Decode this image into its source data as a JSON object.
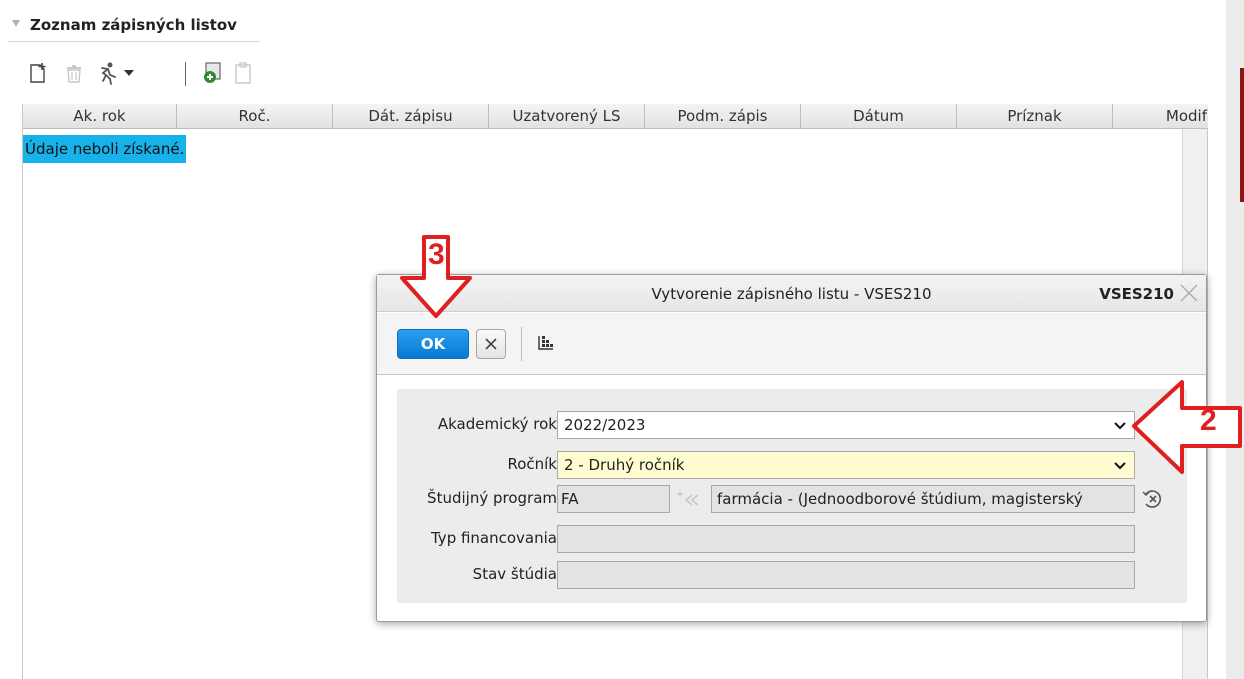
{
  "section": {
    "title": "Zoznam zápisných listov"
  },
  "toolbar": {
    "icons": [
      "new-document-icon",
      "delete-icon",
      "run-icon",
      "dropdown-arrow-icon",
      "import-icon",
      "clipboard-icon"
    ]
  },
  "grid": {
    "columns": [
      "Ak. rok",
      "Roč.",
      "Dát. zápisu",
      "Uzatvorený LS",
      "Podm. zápis",
      "Dátum",
      "Príznak",
      "Modif"
    ],
    "empty_message": "Údaje neboli získané."
  },
  "dialog": {
    "title": "Vytvorenie zápisného listu - VSES210",
    "code": "VSES210",
    "ok_label": "OK",
    "fields": {
      "academic_year": {
        "label": "Akademický rok",
        "value": "2022/2023"
      },
      "year_of_study": {
        "label": "Ročník",
        "value": "2 - Druhý ročník"
      },
      "study_program": {
        "label": "Študijný program",
        "code": "FA",
        "name": "farmácia - (Jednoodborové štúdium, magisterský"
      },
      "financing_type": {
        "label": "Typ financovania",
        "value": ""
      },
      "study_status": {
        "label": "Stav štúdia",
        "value": ""
      }
    }
  },
  "annotations": {
    "step_2": "2",
    "step_3": "3"
  },
  "colors": {
    "ok_button": "#0879d2",
    "highlight": "#17b2ea",
    "required_field": "#fefcd0",
    "annotation": "#e02020"
  }
}
